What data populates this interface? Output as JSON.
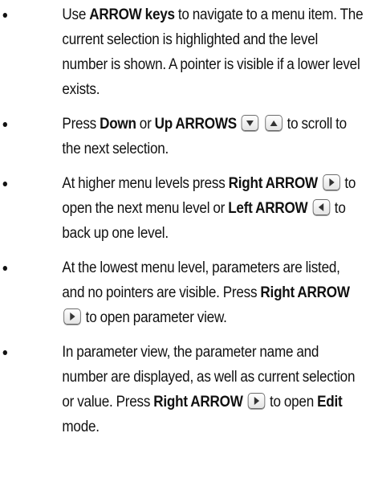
{
  "items": [
    {
      "parts": [
        {
          "t": "text",
          "v": "Use "
        },
        {
          "t": "bold",
          "v": "ARROW keys"
        },
        {
          "t": "text",
          "v": " to navigate to a menu item. The current selection is highlighted and the level number is shown. A pointer is visible if a lower level exists."
        }
      ]
    },
    {
      "parts": [
        {
          "t": "text",
          "v": "Press "
        },
        {
          "t": "bold",
          "v": "Down"
        },
        {
          "t": "text",
          "v": " or "
        },
        {
          "t": "bold",
          "v": "Up ARROWS"
        },
        {
          "t": "text",
          "v": " "
        },
        {
          "t": "key",
          "dir": "down"
        },
        {
          "t": "text",
          "v": " "
        },
        {
          "t": "key",
          "dir": "up"
        },
        {
          "t": "text",
          "v": " to scroll to the next selection."
        }
      ]
    },
    {
      "parts": [
        {
          "t": "text",
          "v": "At higher menu levels press "
        },
        {
          "t": "bold",
          "v": "Right ARROW"
        },
        {
          "t": "text",
          "v": " "
        },
        {
          "t": "key",
          "dir": "right"
        },
        {
          "t": "text",
          "v": " to open the next menu level or "
        },
        {
          "t": "bold",
          "v": "Left ARROW"
        },
        {
          "t": "text",
          "v": " "
        },
        {
          "t": "key",
          "dir": "left"
        },
        {
          "t": "text",
          "v": " to back up one level."
        }
      ]
    },
    {
      "parts": [
        {
          "t": "text",
          "v": "At the lowest menu level, parameters are listed, and no pointers are visible. Press "
        },
        {
          "t": "bold",
          "v": "Right ARROW"
        },
        {
          "t": "text",
          "v": " "
        },
        {
          "t": "key",
          "dir": "right"
        },
        {
          "t": "text",
          "v": " to open parameter view."
        }
      ]
    },
    {
      "parts": [
        {
          "t": "text",
          "v": "In parameter view, the parameter name and number are displayed, as well as current selection or value. Press "
        },
        {
          "t": "bold",
          "v": "Right ARROW"
        },
        {
          "t": "text",
          "v": " "
        },
        {
          "t": "key",
          "dir": "right"
        },
        {
          "t": "text",
          "v": " to open "
        },
        {
          "t": "bold",
          "v": "Edit"
        },
        {
          "t": "text",
          "v": " mode."
        }
      ]
    }
  ],
  "key_icons": {
    "down": "arrow-down-key-icon",
    "up": "arrow-up-key-icon",
    "right": "arrow-right-key-icon",
    "left": "arrow-left-key-icon"
  },
  "colors": {
    "text": "#111111",
    "key_border": "#6b6b6b",
    "key_arrow": "#333333"
  }
}
